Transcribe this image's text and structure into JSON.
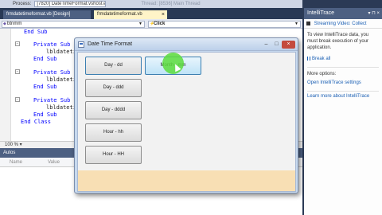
{
  "toolbar": {
    "process_label": "Process:",
    "process_value": "[7820] DateTimeFormat.vshost.exe",
    "faded_text": "Thread:   [8536] Main Thread"
  },
  "tabs": [
    {
      "label": "frmdatetimeformat.vb [Design]"
    },
    {
      "label": "frmdatetimeformat.vb"
    }
  ],
  "nav": {
    "left_value": "btnmm",
    "right_value": "Click"
  },
  "code": {
    "lines": [
      "End Sub",
      "Private Sub bt",
      "lbldatetim",
      "End Sub",
      "Private Sub bt",
      "lbldatetim",
      "End Sub",
      "Private Sub bt",
      "lbldatetim",
      "End Sub",
      "End Class"
    ]
  },
  "zoom": "100 %",
  "autos": {
    "title": "Autos",
    "col_name": "Name",
    "col_value": "Value"
  },
  "intellitrace": {
    "title": "IntelliTrace",
    "streaming_label": "Streaming Video: Collect",
    "info_text": "To view IntelliTrace data, you must break execution of your application.",
    "break_all": "Break all",
    "more_options": "More options:",
    "open_settings": "Open IntelliTrace settings",
    "learn_more": "Learn more about IntelliTrace"
  },
  "dialog": {
    "title": "Date Time Format",
    "buttons": {
      "day_d": "Day - dd",
      "day_ddd": "Day - ddd",
      "day_dddd": "Day - dddd",
      "hour_h": "Hour - hh",
      "hour_H": "Hour - HH",
      "month": "Month - mm"
    }
  }
}
